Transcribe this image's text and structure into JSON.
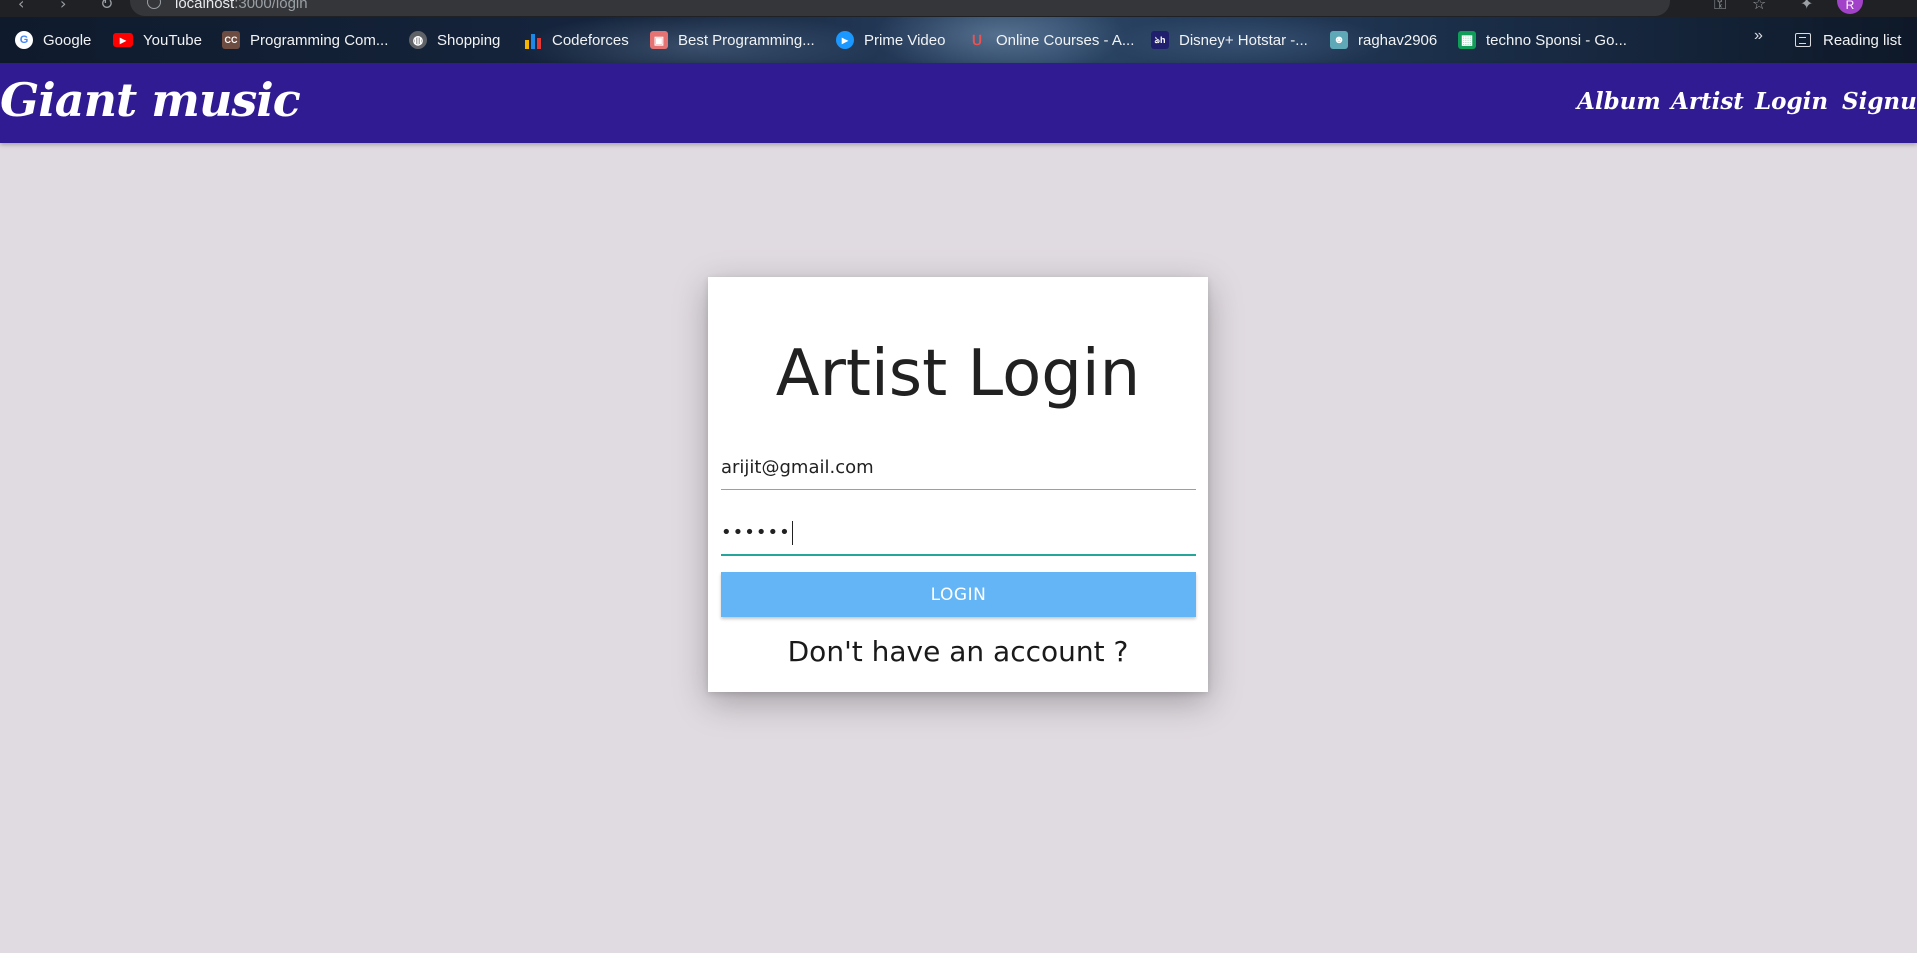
{
  "browser": {
    "url_host": "localhost",
    "url_path": ":3000/login",
    "profile_initial": "R",
    "bookmarks": [
      {
        "label": "Google",
        "icon": "google-icon",
        "color": "#4285f4"
      },
      {
        "label": "YouTube",
        "icon": "youtube-icon",
        "color": "#ff0000"
      },
      {
        "label": "Programming Com...",
        "icon": "cc-icon",
        "color": "#6d4c41"
      },
      {
        "label": "Shopping",
        "icon": "globe-icon",
        "color": "#9aa0a6"
      },
      {
        "label": "Codeforces",
        "icon": "codeforces-icon",
        "color": "#f4b400"
      },
      {
        "label": "Best Programming...",
        "icon": "cube-icon",
        "color": "#e57373"
      },
      {
        "label": "Prime Video",
        "icon": "prime-video-icon",
        "color": "#1a98ff"
      },
      {
        "label": "Online Courses - A...",
        "icon": "udemy-icon",
        "color": "#ec5252"
      },
      {
        "label": "Disney+ Hotstar -...",
        "icon": "hotstar-icon",
        "color": "#1f1f6e"
      },
      {
        "label": "raghav2906",
        "icon": "avatar-icon",
        "color": "#5fa8b8"
      },
      {
        "label": "techno Sponsi - Go...",
        "icon": "sheets-icon",
        "color": "#0f9d58"
      }
    ],
    "reading_list": "Reading list"
  },
  "navbar": {
    "brand": "Giant music",
    "links": [
      "Album",
      "Artist",
      "Login",
      "Signup"
    ]
  },
  "login_card": {
    "title": "Artist Login",
    "email_value": "arijit@gmail.com",
    "password_mask": "••••••",
    "login_button": "LOGIN",
    "signup_prompt": "Don't have an account ?"
  },
  "colors": {
    "navbar": "#311b92",
    "button": "#64b5f6",
    "active_underline": "#26a69a",
    "page_bg": "#e0dbe1"
  }
}
